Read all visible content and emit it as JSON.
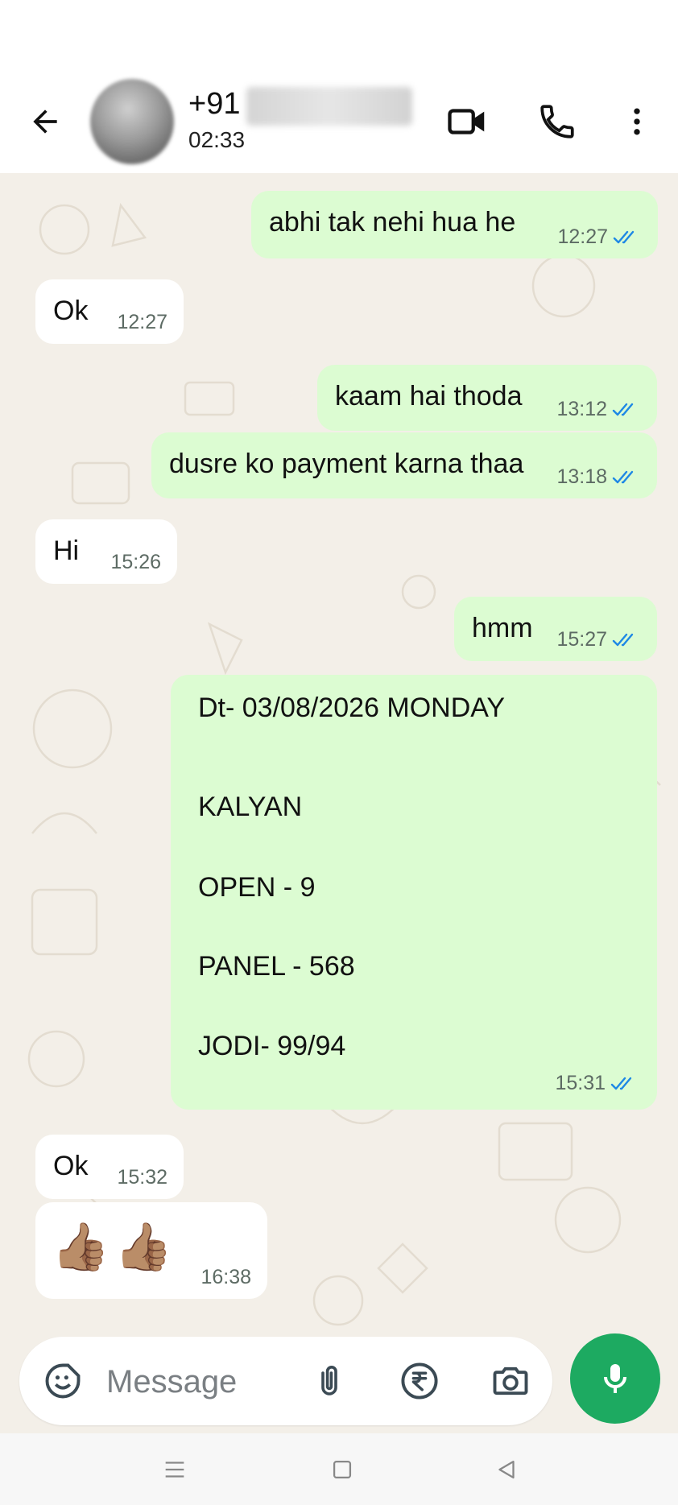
{
  "header": {
    "contact_prefix": "+91",
    "status": "02:33",
    "icons": [
      "back-arrow-icon",
      "avatar",
      "video-call-icon",
      "voice-call-icon",
      "more-options-icon"
    ]
  },
  "messages": [
    {
      "dir": "out",
      "text": "abhi tak nehi hua he",
      "time": "12:27",
      "read": true
    },
    {
      "dir": "in",
      "text": "Ok",
      "time": "12:27"
    },
    {
      "dir": "out",
      "text": "kaam hai thoda",
      "time": "13:12",
      "read": true
    },
    {
      "dir": "out",
      "text": "dusre ko payment karna thaa",
      "time": "13:18",
      "read": true
    },
    {
      "dir": "in",
      "text": "Hi",
      "time": "15:26"
    },
    {
      "dir": "out",
      "text": "hmm",
      "time": "15:27",
      "read": true
    },
    {
      "dir": "out",
      "lines": [
        "Dt- 03/08/2026 MONDAY",
        "",
        "KALYAN",
        "OPEN - 9",
        "PANEL - 568",
        "JODI- 99/94"
      ],
      "time": "15:31",
      "read": true
    },
    {
      "dir": "in",
      "text": "Ok",
      "time": "15:32"
    },
    {
      "dir": "in",
      "text": "👍🏽👍🏽",
      "time": "16:38"
    }
  ],
  "composer": {
    "placeholder": "Message",
    "icons": [
      "sticker-icon",
      "attach-icon",
      "rupee-payment-icon",
      "camera-icon",
      "mic-icon"
    ]
  },
  "colors": {
    "outgoing_bubble": "#dcfcd2",
    "incoming_bubble": "#ffffff",
    "chat_background": "#f3efe8",
    "read_tick": "#1e88e5",
    "mic_button": "#1daa61"
  }
}
